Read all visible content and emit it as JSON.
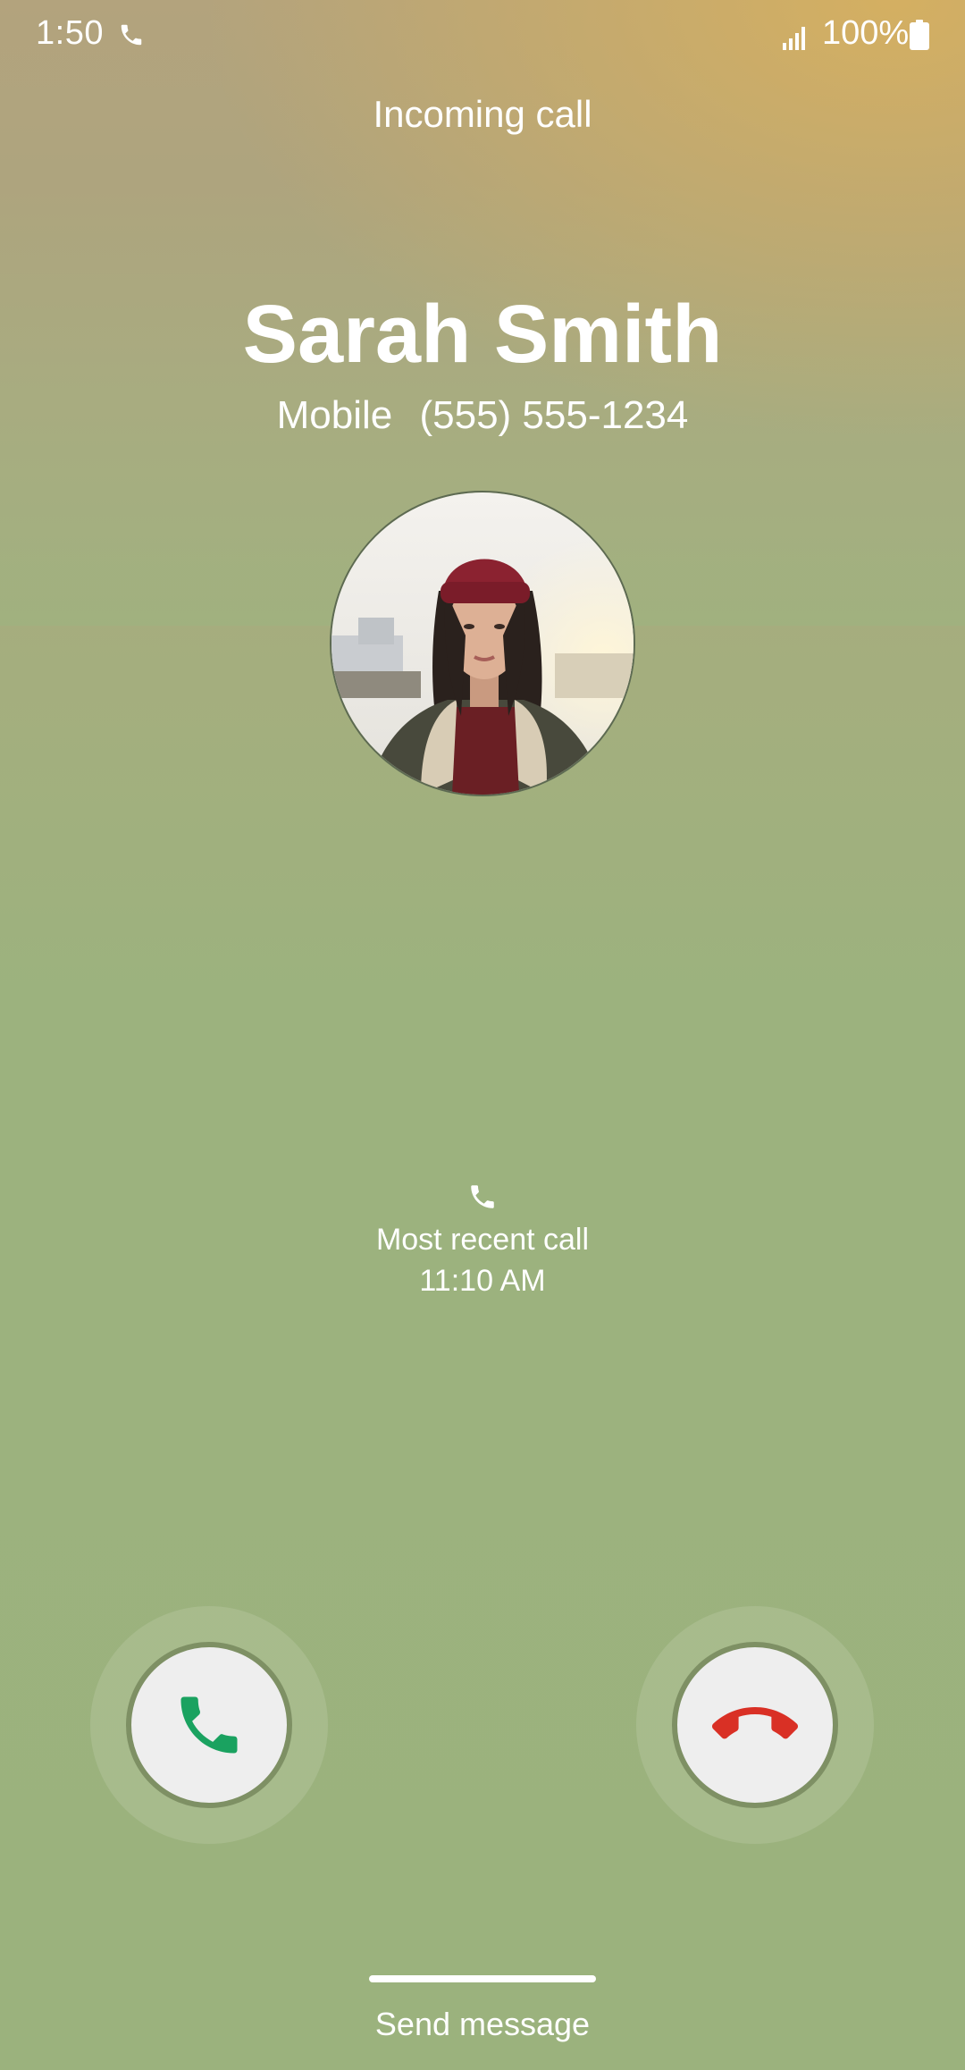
{
  "status_bar": {
    "time": "1:50",
    "battery": "100%",
    "icons": [
      "call-icon",
      "signal-icon",
      "battery-icon"
    ]
  },
  "call": {
    "state_label": "Incoming call",
    "caller_name": "Sarah Smith",
    "number_type": "Mobile",
    "number": "(555) 555-1234"
  },
  "recent": {
    "title": "Most recent call",
    "time": "11:10 AM"
  },
  "actions": {
    "answer_icon": "phone-icon",
    "decline_icon": "hang-up-icon",
    "send_message_label": "Send message"
  },
  "colors": {
    "answer": "#1aa260",
    "decline": "#d93025",
    "background": "#9db27e"
  }
}
